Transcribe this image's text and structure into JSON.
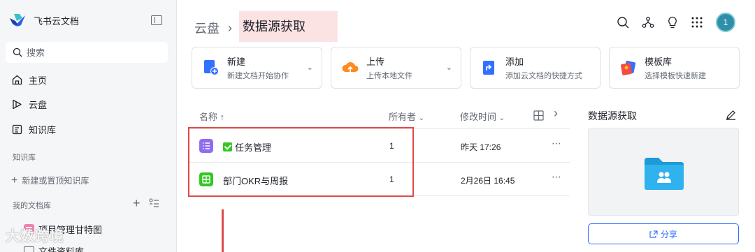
{
  "sidebar": {
    "brand": "飞书云文档",
    "search_placeholder": "搜索",
    "nav": [
      {
        "label": "主页",
        "icon": "home-icon"
      },
      {
        "label": "云盘",
        "icon": "drive-icon"
      },
      {
        "label": "知识库",
        "icon": "wiki-icon"
      }
    ],
    "wiki_section": "知识库",
    "new_wiki": "新建或置顶知识库",
    "my_docs_section": "我的文档库",
    "tree": [
      {
        "label": "项目管理甘特图",
        "icon": "gantt-icon"
      },
      {
        "label": "文件资料库",
        "icon": "folder-icon"
      }
    ],
    "watermark": "大数跨境"
  },
  "header": {
    "breadcrumb_root": "云盘",
    "breadcrumb_current": "数据源获取",
    "avatar": "1",
    "icons": [
      "search-icon",
      "share-tree-icon",
      "bulb-icon",
      "apps-grid-icon"
    ]
  },
  "cards": [
    {
      "title": "新建",
      "subtitle": "新建文档开始协作",
      "icon": "new-doc-icon",
      "chevron": true
    },
    {
      "title": "上传",
      "subtitle": "上传本地文件",
      "icon": "upload-icon",
      "chevron": true
    },
    {
      "title": "添加",
      "subtitle": "添加云文档的快捷方式",
      "icon": "shortcut-icon",
      "chevron": false
    },
    {
      "title": "模板库",
      "subtitle": "选择模板快速新建",
      "icon": "template-icon",
      "chevron": false
    }
  ],
  "table": {
    "col_name": "名称 ↑",
    "col_owner": "所有者",
    "col_modified": "修改时间",
    "rows": [
      {
        "name": "任务管理",
        "owner": "1",
        "modified": "昨天 17:26",
        "icon": "task-list-icon"
      },
      {
        "name": "部门OKR与周报",
        "owner": "1",
        "modified": "2月26日 16:45",
        "icon": "sheet-icon"
      }
    ]
  },
  "panel": {
    "title": "数据源获取",
    "share_label": "分享"
  },
  "colors": {
    "accent": "#3370ff",
    "highlight": "#e04b4b",
    "breadcrumb_bg": "#fce3e3"
  }
}
